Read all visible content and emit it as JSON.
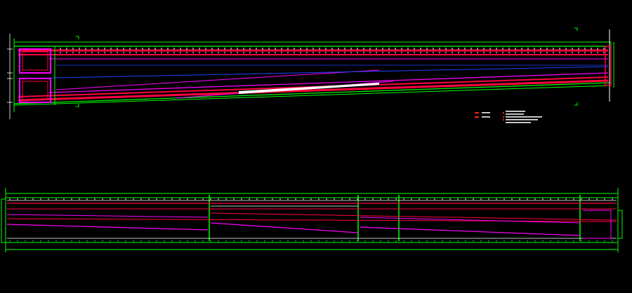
{
  "app": {
    "type": "CAD drawing viewer (screenshot of drawing canvas)",
    "background": "#000000"
  },
  "colors": {
    "frame": "#00ff00",
    "rebar": "#ff0040",
    "dim": "#ff00ff",
    "centerline": "#2040ff",
    "text": "#ffffff",
    "annotation_red": "#ff2020"
  },
  "drawing": {
    "plan_view": {
      "label": "",
      "legend_note_lines": [
        "",
        "",
        "",
        "",
        ""
      ]
    },
    "elevation_view": {
      "label": ""
    }
  }
}
